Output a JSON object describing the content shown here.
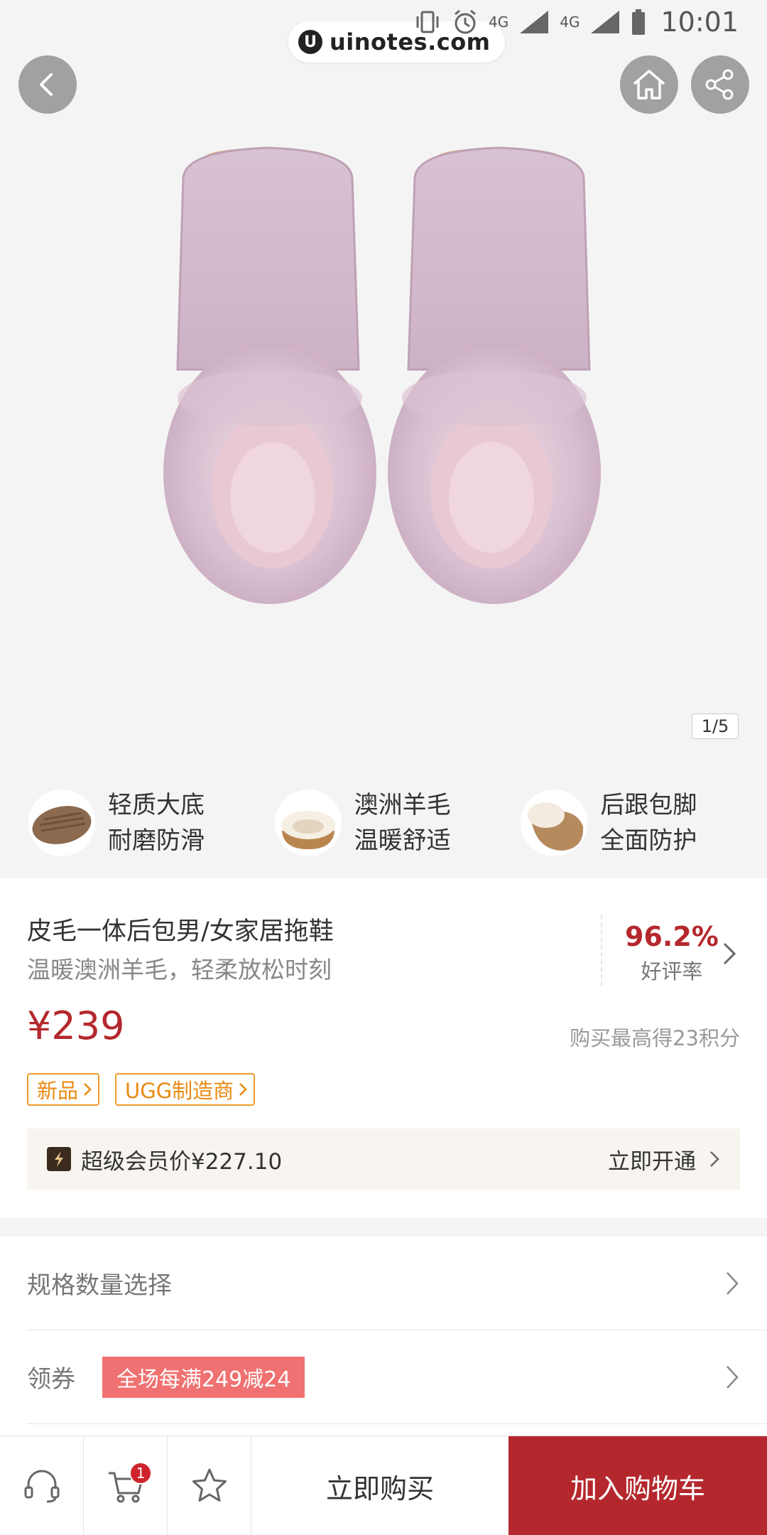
{
  "status": {
    "time": "10:01",
    "net1": "4G",
    "net2": "4G"
  },
  "watermark": {
    "logo": "U",
    "text": "uinotes.com"
  },
  "hero": {
    "pager": "1/5"
  },
  "features": [
    {
      "line1": "轻质大底",
      "line2": "耐磨防滑"
    },
    {
      "line1": "澳洲羊毛",
      "line2": "温暖舒适"
    },
    {
      "line1": "后跟包脚",
      "line2": "全面防护"
    }
  ],
  "product": {
    "title": "皮毛一体后包男/女家居拖鞋",
    "subtitle": "温暖澳洲羊毛，轻柔放松时刻",
    "rating_value": "96.2%",
    "rating_label": "好评率",
    "price": "¥239",
    "points": "购买最高得23积分",
    "tags": [
      "新品",
      "UGG制造商"
    ],
    "vip_price": "超级会员价¥227.10",
    "vip_cta": "立即开通"
  },
  "rows": {
    "spec_label": "规格数量选择",
    "coupon_label": "领券",
    "coupon_text": "全场每满249减24"
  },
  "bottom": {
    "cart_count": "1",
    "buy_now": "立即购买",
    "add_cart": "加入购物车"
  },
  "colors": {
    "brand": "#b4282d",
    "tag": "#f09a2a",
    "coupon": "#f07171"
  }
}
